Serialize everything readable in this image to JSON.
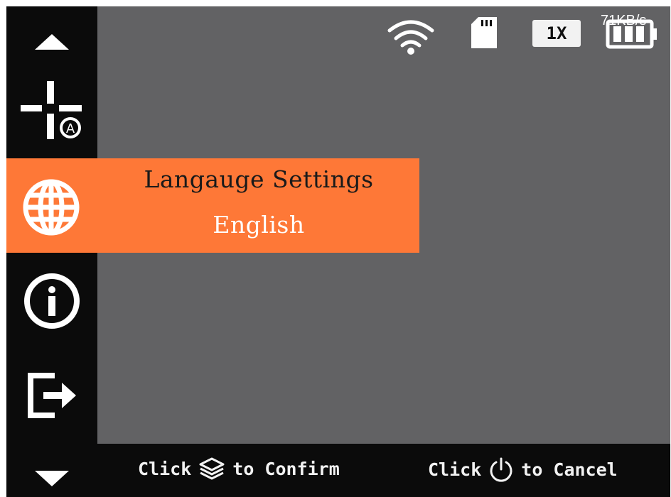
{
  "menu": {
    "title": "Langauge Settings",
    "value": "English"
  },
  "status": {
    "zoom": "1X",
    "network_speed": "71KB/s"
  },
  "footer": {
    "confirm_prefix": "Click",
    "confirm_suffix": "to Confirm",
    "cancel_prefix": "Click",
    "cancel_suffix": "to Cancel"
  },
  "icons": {
    "scroll_up": "triangle-up-icon",
    "reticle": "reticle-auto-icon",
    "language": "globe-icon",
    "info": "info-icon",
    "exit": "exit-icon",
    "scroll_down": "triangle-down-icon",
    "wifi": "wifi-icon",
    "sd_card": "sd-card-icon",
    "battery": "battery-icon",
    "confirm": "layers-icon",
    "cancel": "power-icon"
  },
  "colors": {
    "highlight": "#fe7837",
    "viewport": "#626264",
    "background": "#0b0b0b"
  }
}
